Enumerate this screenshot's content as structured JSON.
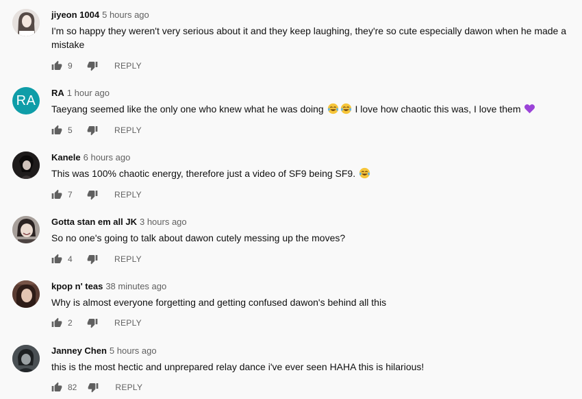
{
  "comments": [
    {
      "author": "jiyeon 1004",
      "time": "5 hours ago",
      "text": "I'm so happy they weren't very serious about it and they keep laughing, they're so cute especially dawon when he made a mistake",
      "likes": "9",
      "reply_label": "REPLY",
      "avatar": {
        "type": "photo",
        "bg": "#d9d3d0"
      }
    },
    {
      "author": "RA",
      "time": "1 hour ago",
      "text_before": "Taeyang seemed like the only one who knew what he was doing ",
      "text_after": " I love how chaotic this was, I love them ",
      "emoji_1": "face-with-tears-of-joy",
      "emoji_2": "purple-heart",
      "likes": "5",
      "reply_label": "REPLY",
      "avatar": {
        "type": "letter",
        "letter": "RA",
        "bg": "#0f9da8"
      }
    },
    {
      "author": "Kanele",
      "time": "6 hours ago",
      "text_before": "This was 100% chaotic energy, therefore just a video of SF9 being SF9. ",
      "emoji_1": "face-with-tears-of-joy",
      "likes": "7",
      "reply_label": "REPLY",
      "avatar": {
        "type": "photo",
        "bg": "#2a2626"
      }
    },
    {
      "author": "Gotta stan em all JK",
      "time": "3 hours ago",
      "text": "So no one's going to talk about dawon cutely messing up the moves?",
      "likes": "4",
      "reply_label": "REPLY",
      "avatar": {
        "type": "photo",
        "bg": "#b9b2ad"
      }
    },
    {
      "author": "kpop n' teas",
      "time": "38 minutes ago",
      "text": "Why is almost everyone forgetting and getting confused dawon's behind all this",
      "likes": "2",
      "reply_label": "REPLY",
      "avatar": {
        "type": "photo",
        "bg": "#6a4a3e"
      }
    },
    {
      "author": "Janney Chen",
      "time": "5 hours ago",
      "text": "this is the most hectic and unprepared relay dance i've ever seen HAHA this is hilarious!",
      "likes": "82",
      "reply_label": "REPLY",
      "avatar": {
        "type": "photo",
        "bg": "#3a3f42"
      }
    }
  ],
  "colors": {
    "background": "#f9f9f9",
    "text_primary": "#0f0f0f",
    "text_secondary": "#606060",
    "icon": "#606060"
  }
}
